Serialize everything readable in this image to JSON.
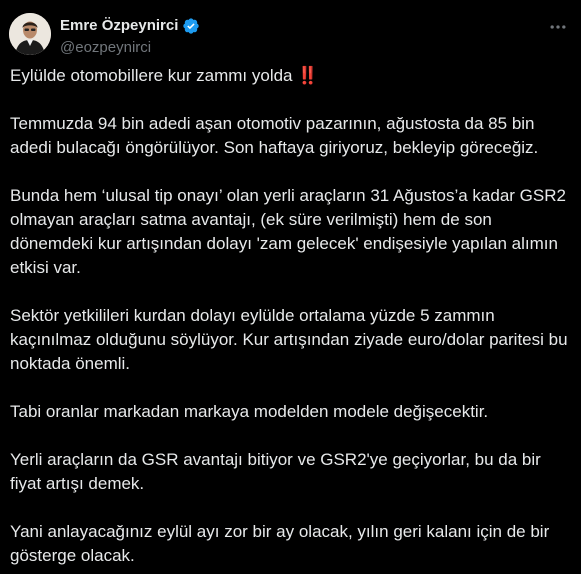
{
  "author": {
    "display_name": "Emre Özpeynirci",
    "handle": "@eozpeynirci",
    "verified": true,
    "verified_color": "#1d9bf0"
  },
  "icons": {
    "verified": "verified-badge-icon",
    "more": "more-horizontal-icon",
    "emoji": "double-exclamation-emoji"
  },
  "tweet": {
    "first_line": "Eylülde otomobillere kur zammı yolda",
    "first_line_emoji": "‼️",
    "paragraphs": [
      "Temmuzda 94 bin adedi aşan otomotiv pazarının, ağustosta da 85 bin adedi bulacağı öngörülüyor. Son haftaya giriyoruz, bekleyip göreceğiz.",
      "Bunda hem ‘ulusal tip onayı’ olan yerli araçların 31 Ağustos’a kadar GSR2 olmayan araçları satma avantajı, (ek süre verilmişti) hem de son dönemdeki kur artışından dolayı 'zam gelecek' endişesiyle yapılan alımın etkisi var.",
      "Sektör yetkilileri kurdan dolayı eylülde ortalama yüzde 5 zammın kaçınılmaz olduğunu söylüyor. Kur artışından ziyade euro/dolar paritesi bu noktada önemli.",
      "Tabi oranlar markadan markaya modelden modele değişecektir.",
      "Yerli araçların da GSR avantajı bitiyor ve GSR2'ye geçiyorlar, bu da bir fiyat artışı demek.",
      "Yani anlayacağınız eylül ayı zor bir ay olacak, yılın geri kalanı için de bir gösterge olacak."
    ]
  },
  "colors": {
    "background": "#000000",
    "text_primary": "#e7e9ea",
    "text_secondary": "#71767b",
    "emoji_red": "#e0245e"
  }
}
